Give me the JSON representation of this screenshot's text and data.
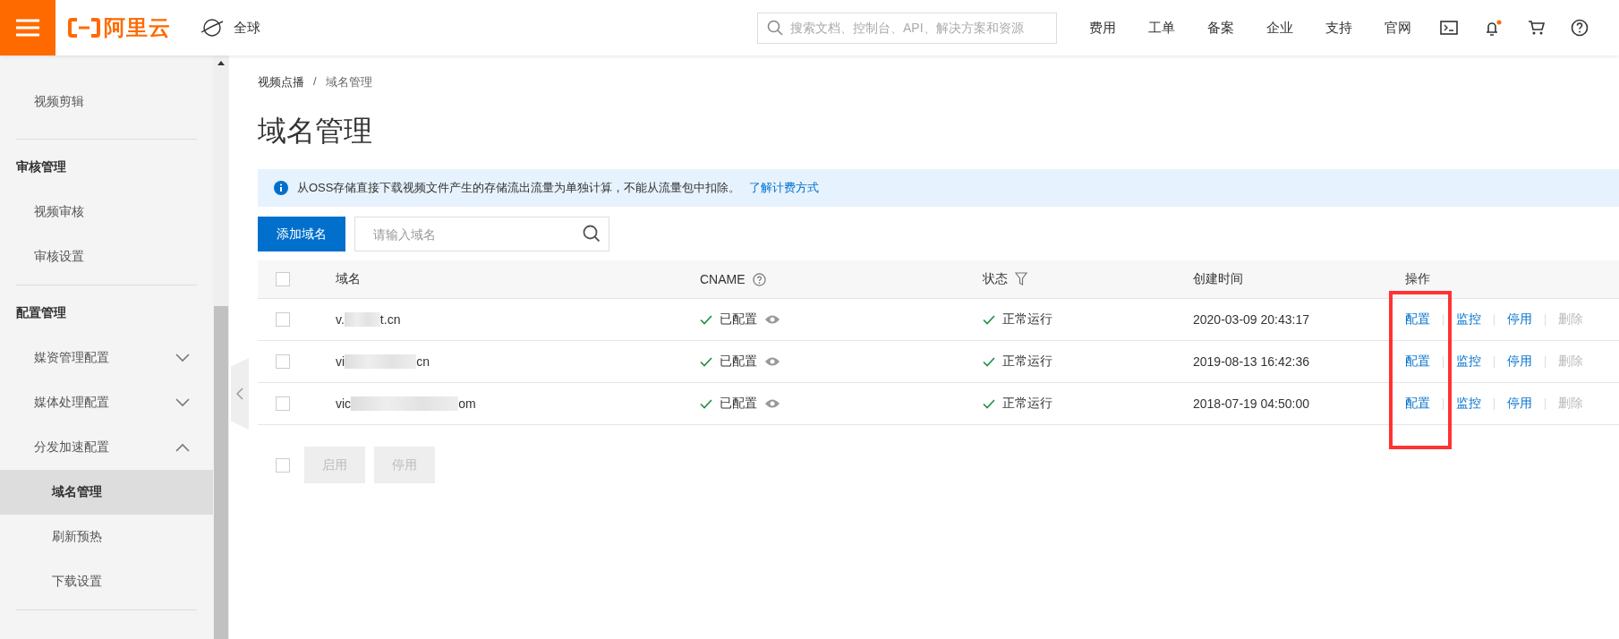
{
  "topbar": {
    "logo": "阿里云",
    "region": "全球",
    "search": {
      "placeholder": "搜索文档、控制台、API、解决方案和资源"
    },
    "nav": [
      "费用",
      "工单",
      "备案",
      "企业",
      "支持",
      "官网"
    ]
  },
  "sidebar": {
    "sections": [
      {
        "items": [
          {
            "label": "视频剪辑",
            "selected": false
          }
        ]
      },
      {
        "title": "审核管理",
        "items": [
          {
            "label": "视频审核",
            "selected": false
          },
          {
            "label": "审核设置",
            "selected": false
          }
        ]
      },
      {
        "title": "配置管理",
        "items": [
          {
            "label": "媒资管理配置",
            "expanded": false
          },
          {
            "label": "媒体处理配置",
            "expanded": false
          },
          {
            "label": "分发加速配置",
            "expanded": true,
            "children": [
              {
                "label": "域名管理",
                "selected": true
              },
              {
                "label": "刷新预热",
                "selected": false
              },
              {
                "label": "下载设置",
                "selected": false
              }
            ]
          }
        ]
      }
    ]
  },
  "breadcrumb": [
    "视频点播",
    "域名管理"
  ],
  "breadcrumb_separator": "/",
  "title": "域名管理",
  "notice": {
    "text": "从OSS存储直接下载视频文件产生的存储流出流量为单独计算，不能从流量包中扣除。",
    "link": "了解计费方式"
  },
  "add_button": "添加域名",
  "domain_search": {
    "placeholder": "请输入域名"
  },
  "table": {
    "all_checked": false,
    "columns": [
      "域名",
      "CNAME",
      "状态",
      "创建时间",
      "操作"
    ],
    "rows": [
      {
        "checked": false,
        "domain_start": "v.",
        "domain_end": "t.cn",
        "cname": "已配置",
        "status": "正常运行",
        "created": "2020-03-09 20:43:17",
        "actions": [
          {
            "label": "配置",
            "disabled": false
          },
          {
            "label": "监控",
            "disabled": false
          },
          {
            "label": "停用",
            "disabled": false
          },
          {
            "label": "删除",
            "disabled": true
          }
        ]
      },
      {
        "checked": false,
        "domain_start": "vi",
        "domain_end": "cn",
        "cname": "已配置",
        "status": "正常运行",
        "created": "2019-08-13 16:42:36",
        "actions": [
          {
            "label": "配置",
            "disabled": false
          },
          {
            "label": "监控",
            "disabled": false
          },
          {
            "label": "停用",
            "disabled": false
          },
          {
            "label": "删除",
            "disabled": true
          }
        ]
      },
      {
        "checked": false,
        "domain_start": "vic",
        "domain_end": "om",
        "cname": "已配置",
        "status": "正常运行",
        "created": "2018-07-19 04:50:00",
        "actions": [
          {
            "label": "配置",
            "disabled": false
          },
          {
            "label": "监控",
            "disabled": false
          },
          {
            "label": "停用",
            "disabled": false
          },
          {
            "label": "删除",
            "disabled": true
          }
        ]
      }
    ]
  },
  "bulk": {
    "checked": false,
    "buttons": [
      {
        "label": "启用",
        "disabled": true
      },
      {
        "label": "停用",
        "disabled": true
      }
    ]
  }
}
